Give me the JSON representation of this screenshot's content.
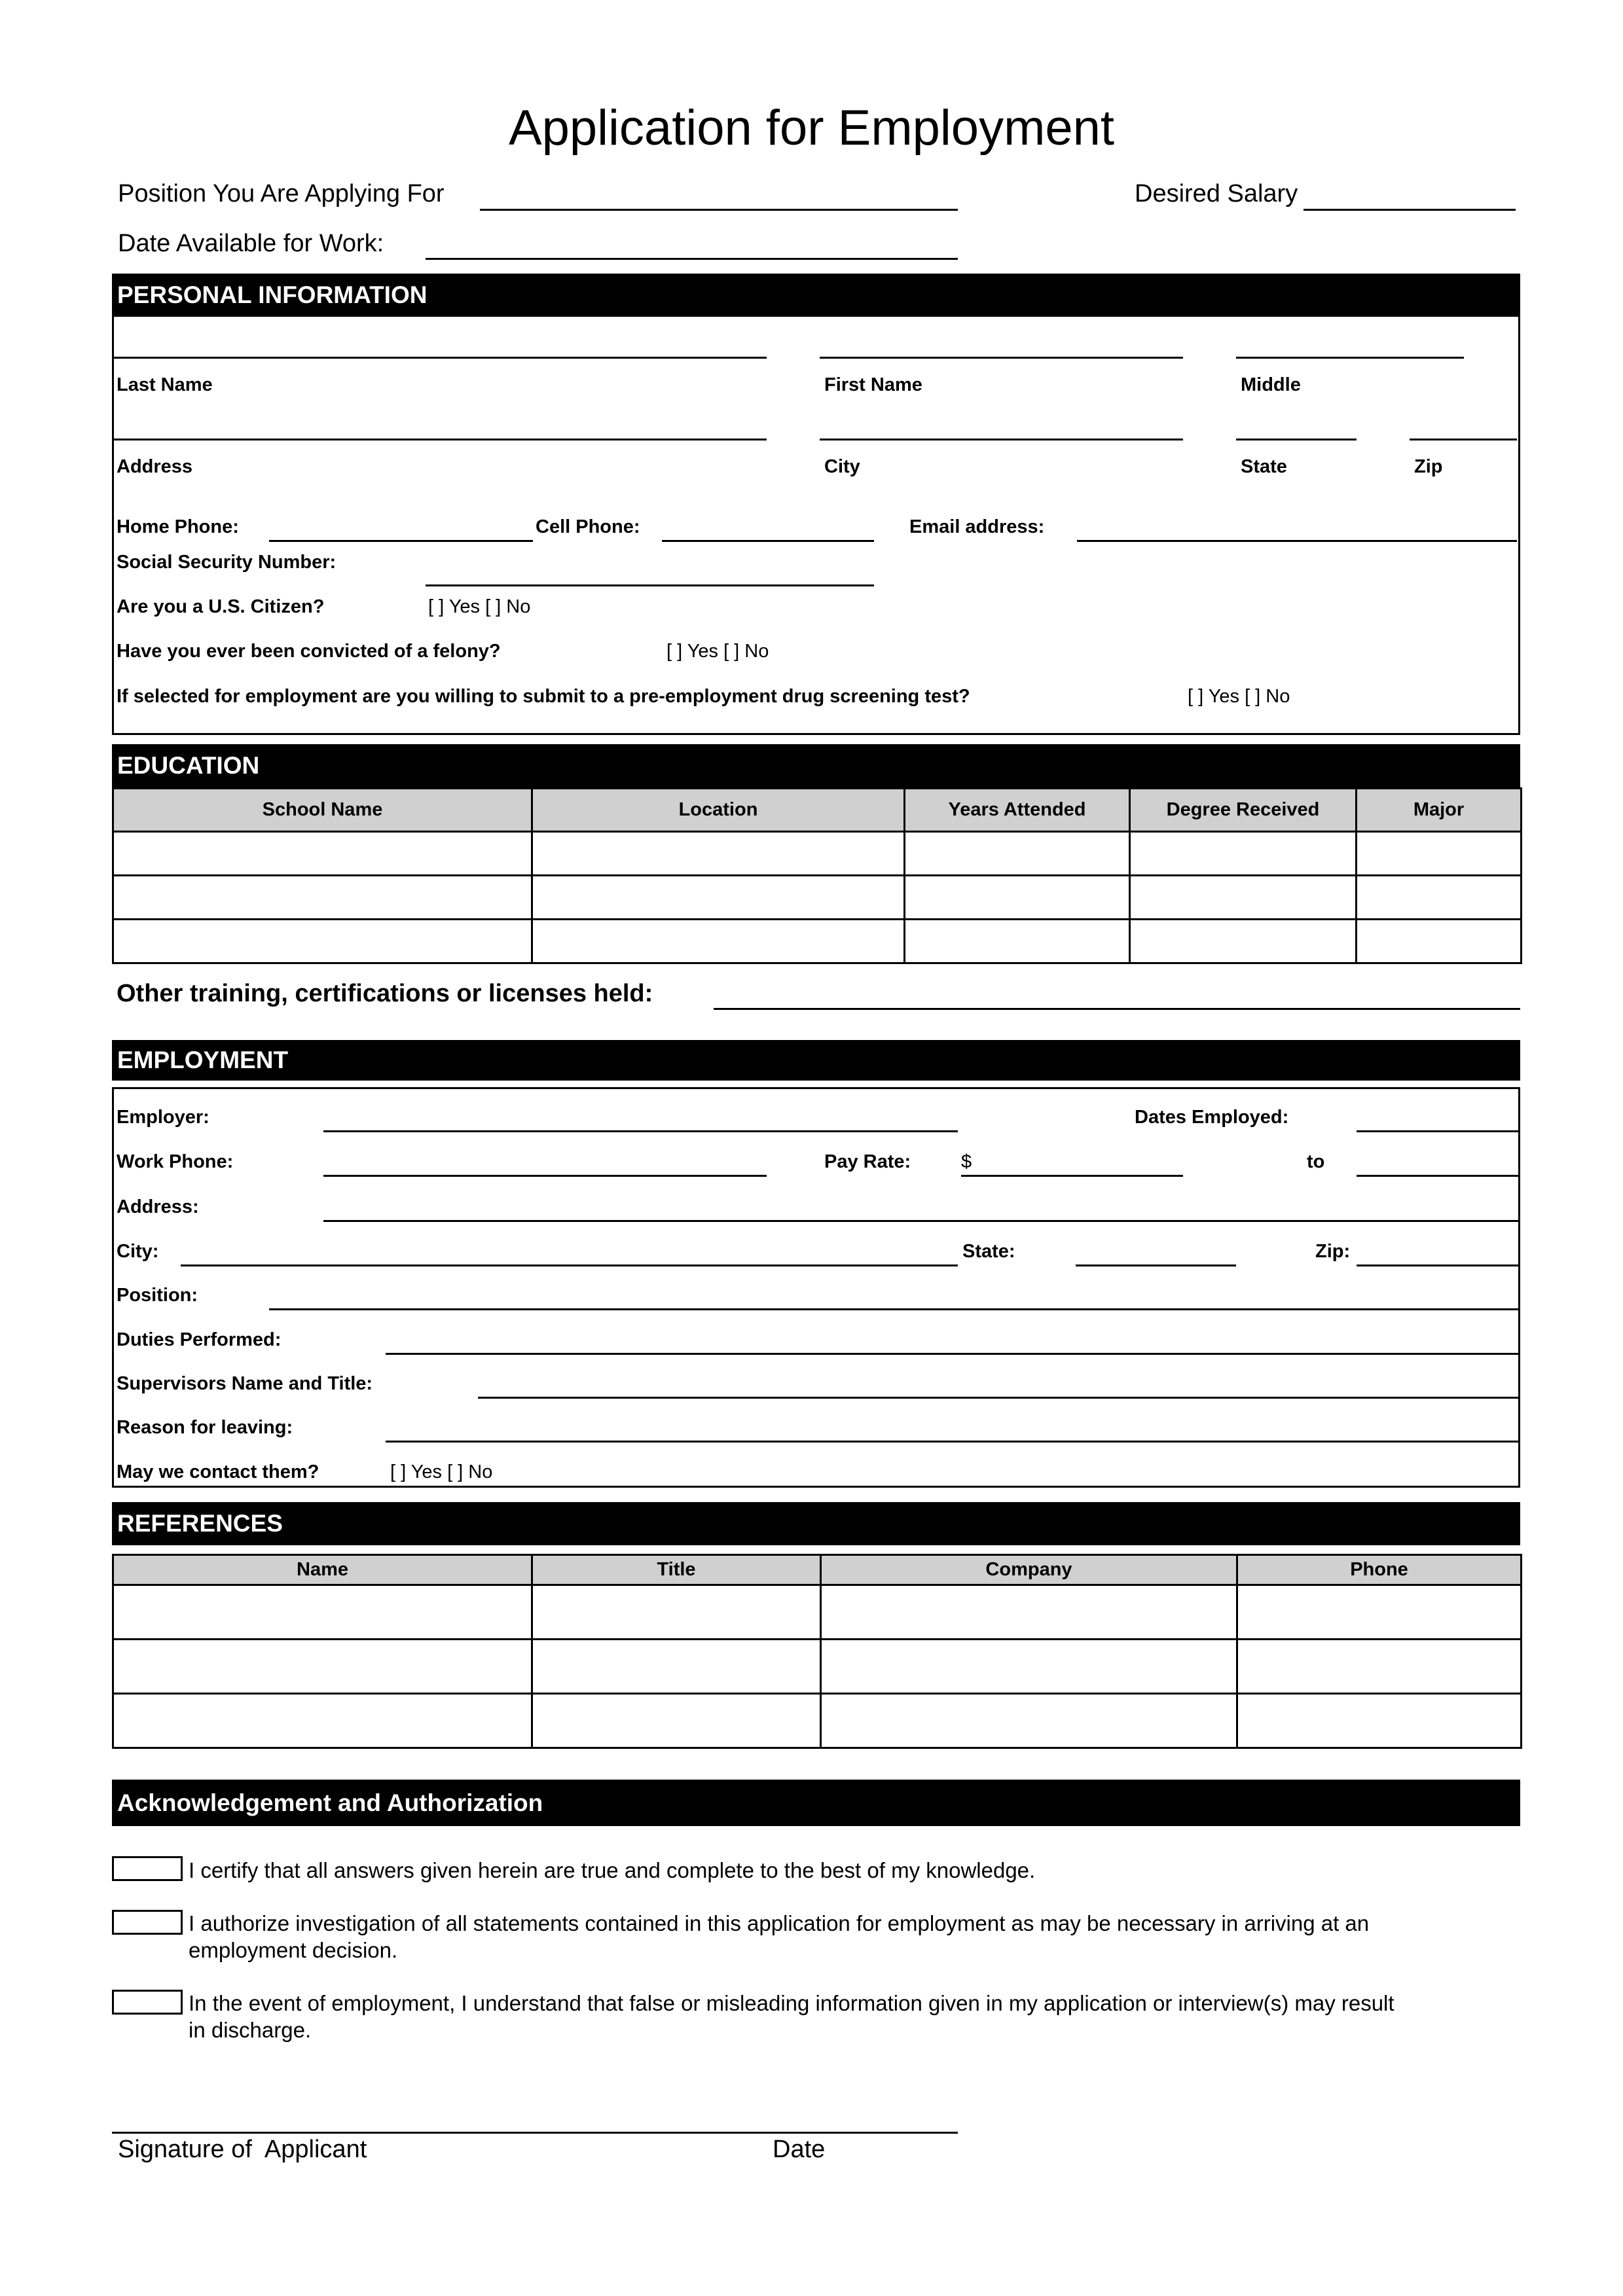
{
  "title": "Application for Employment",
  "header": {
    "position_label": "Position You Are Applying For",
    "salary_label": "Desired Salary",
    "date_label": "Date Available for Work:"
  },
  "personal": {
    "heading": "PERSONAL INFORMATION",
    "last_name": "Last Name",
    "first_name": "First Name",
    "middle": "Middle",
    "address": "Address",
    "city": "City",
    "state": "State",
    "zip": "Zip",
    "home_phone": "Home Phone:",
    "cell_phone": "Cell Phone:",
    "email": "Email address:",
    "ssn": "Social Security Number:",
    "citizen": "Are you a U.S. Citizen?",
    "felony": "Have you ever been convicted of a felony?",
    "drug": "If selected for employment are you willing to submit to a pre-employment drug screening test?",
    "yes_no": "[  ]  Yes [  ]  No"
  },
  "education": {
    "heading": "EDUCATION",
    "columns": [
      "School Name",
      "Location",
      "Years Attended",
      "Degree Received",
      "Major"
    ],
    "other_training": "Other training, certifications or licenses held:"
  },
  "employment": {
    "heading": "EMPLOYMENT",
    "employer": "Employer:",
    "dates_employed": "Dates Employed:",
    "work_phone": "Work Phone:",
    "pay_rate": "Pay Rate:",
    "dollar": "$",
    "to": "to",
    "address": "Address:",
    "city": "City:",
    "state": "State:",
    "zip": "Zip:",
    "position": "Position:",
    "duties": "Duties Performed:",
    "supervisor": "Supervisors Name and Title:",
    "reason": "Reason for leaving:",
    "contact": "May we contact them?",
    "yes_no": "[  ]  Yes [  ]  No"
  },
  "references": {
    "heading": "REFERENCES",
    "columns": [
      "Name",
      "Title",
      "Company",
      "Phone"
    ]
  },
  "acknowledgement": {
    "heading": "Acknowledgement and Authorization",
    "statements": [
      "I certify that all answers given herein are true and complete to the best of my knowledge.",
      "I authorize investigation of all statements contained in this application for employment as may be necessary in arriving at an employment decision.",
      "In the event of employment, I understand that false or misleading information given in my application or interview(s) may result in discharge."
    ]
  },
  "signature": {
    "applicant_label": "Signature of  Applicant",
    "date_label": "Date"
  }
}
